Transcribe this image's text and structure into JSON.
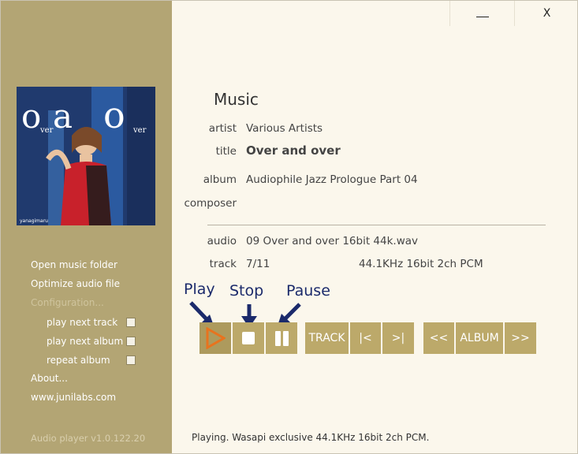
{
  "window": {
    "minimize_label": "—",
    "close_label": "X"
  },
  "sidebar": {
    "cover_text": "yanagimaru",
    "menu": [
      {
        "label": "Open music folder"
      },
      {
        "label": "Optimize audio file"
      },
      {
        "label": "Configuration..."
      }
    ],
    "options": [
      {
        "label": "play next track",
        "checked": false
      },
      {
        "label": "play next album",
        "checked": false
      },
      {
        "label": "repeat album",
        "checked": false
      }
    ],
    "about_label": "About...",
    "website_label": "www.junilabs.com",
    "version": "Audio player v1.0.122.20"
  },
  "info": {
    "heading": "Music",
    "artist_label": "artist",
    "artist": "Various Artists",
    "title_label": "title",
    "title": "Over and over",
    "album_label": "album",
    "album": "Audiophile Jazz Prologue Part 04",
    "composer_label": "composer",
    "composer": "",
    "audio_label": "audio",
    "audio": "09 Over and over 16bit 44k.wav",
    "track_label": "track",
    "track": "7/11",
    "format": "44.1KHz 16bit 2ch PCM"
  },
  "annotations": {
    "play": "Play",
    "stop": "Stop",
    "pause": "Pause",
    "color": "#1b2a6b"
  },
  "controls": {
    "play_icon": "play-icon",
    "stop_icon": "stop-icon",
    "pause_icon": "pause-icon",
    "track_label": "TRACK",
    "prev_track_label": "|<",
    "next_track_label": ">|",
    "prev_album_label": "<<",
    "album_label": "ALBUM",
    "next_album_label": ">>",
    "accent_color": "#bca96a",
    "play_color": "#e8731e"
  },
  "status": "Playing. Wasapi exclusive 44.1KHz 16bit 2ch PCM."
}
